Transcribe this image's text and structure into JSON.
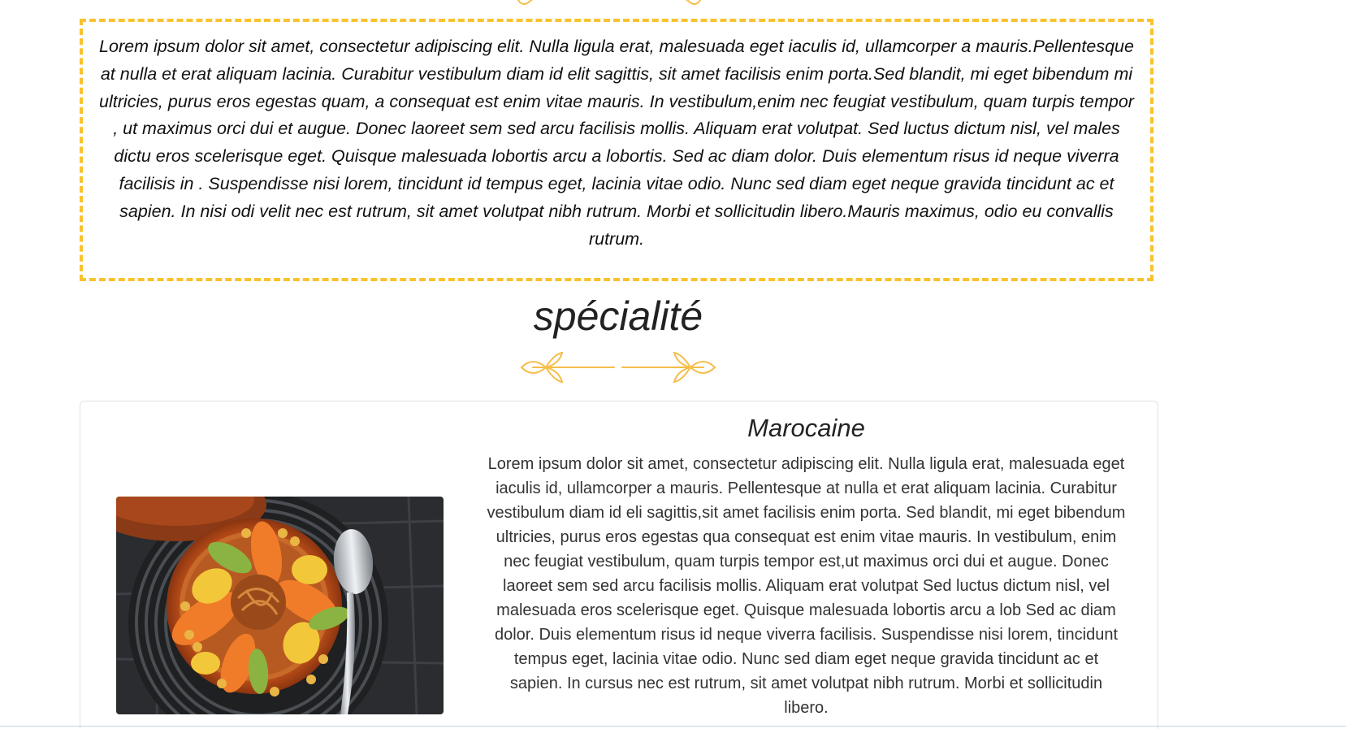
{
  "intro": {
    "text": "Lorem ipsum dolor sit amet, consectetur adipiscing elit. Nulla ligula erat, malesuada eget iaculis id, ullamcorper a mauris.Pellentesque at nulla et erat aliquam lacinia. Curabitur vestibulum diam id elit sagittis, sit amet facilisis enim porta.Sed blandit, mi eget bibendum mi ultricies, purus eros egestas quam, a consequat est enim vitae mauris. In vestibulum,enim nec feugiat vestibulum, quam turpis tempor , ut maximus orci dui et augue. Donec laoreet sem sed arcu facilisis mollis. Aliquam erat volutpat. Sed luctus dictum nisl, vel males dictu eros scelerisque eget. Quisque malesuada lobortis arcu a lobortis. Sed ac diam dolor. Duis elementum risus id neque viverra facilisis in . Suspendisse nisi lorem, tincidunt id tempus eget, lacinia vitae odio. Nunc sed diam eget neque gravida tincidunt ac et sapien. In nisi odi velit nec est rutrum, sit amet volutpat nibh rutrum. Morbi et sollicitudin libero.Mauris maximus, odio eu convallis rutrum."
  },
  "section": {
    "title": "spécialité"
  },
  "card": {
    "title": "Marocaine",
    "text": "Lorem ipsum dolor sit amet, consectetur adipiscing elit. Nulla ligula erat, malesuada eget iaculis id, ullamcorper a mauris. Pellentesque at nulla et erat aliquam lacinia. Curabitur vestibulum diam id eli sagittis,sit amet facilisis enim porta. Sed blandit, mi eget bibendum ultricies, purus eros egestas qua consequat est enim vitae mauris. In vestibulum, enim nec feugiat vestibulum, quam turpis tempor est,ut maximus orci dui et augue. Donec laoreet sem sed arcu facilisis mollis. Aliquam erat volutpat Sed luctus dictum nisl, vel malesuada eros scelerisque eget. Quisque malesuada lobortis arcu a lob Sed ac diam dolor. Duis elementum risus id neque viverra facilisis. Suspendisse nisi lorem, tincidunt tempus eget, lacinia vitae odio. Nunc sed diam eget neque gravida tincidunt ac et sapien. In cursus nec est rutrum, sit amet volutpat nibh rutrum. Morbi et sollicitudin libero.",
    "image": "couscous-tagine-photo"
  },
  "colors": {
    "accent": "#f9c22e",
    "ornament": "#f6bd4a",
    "card_border": "#dee2e6"
  },
  "icons": {
    "top_divider": "leaf-divider-icon",
    "section_divider": "leaf-divider-icon"
  }
}
